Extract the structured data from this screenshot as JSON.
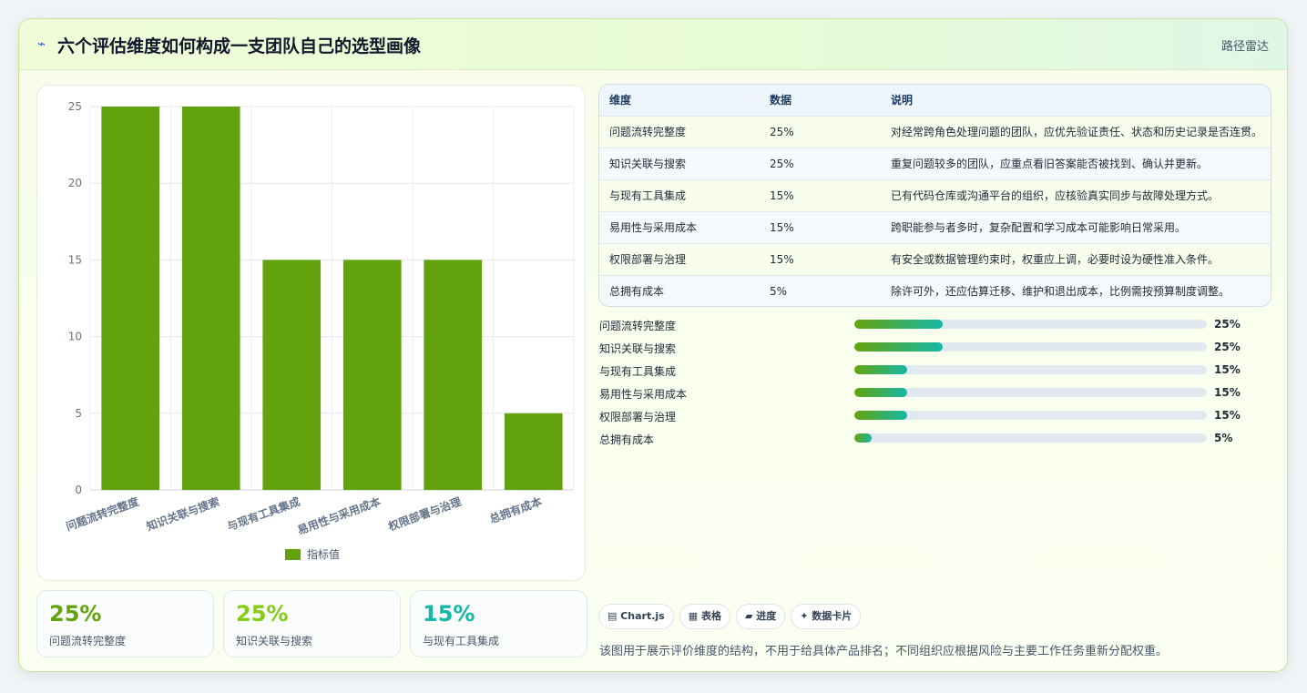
{
  "header": {
    "icon": "chart-line-icon",
    "title": "六个评估维度如何构成一支团队自己的选型画像",
    "right_label": "路径雷达"
  },
  "colors": {
    "bar": "#62a30d",
    "accent_green": "#65a30d",
    "accent_teal": "#14b8a6",
    "lime": "#84cc16"
  },
  "chart_data": {
    "type": "bar",
    "categories": [
      "问题流转完整度",
      "知识关联与搜索",
      "与现有工具集成",
      "易用性与采用成本",
      "权限部署与治理",
      "总拥有成本"
    ],
    "series": [
      {
        "name": "指标值",
        "values": [
          25,
          25,
          15,
          15,
          15,
          5
        ]
      }
    ],
    "ylim": [
      0,
      25
    ],
    "yticks": [
      0,
      5,
      10,
      15,
      20,
      25
    ],
    "grid": true,
    "legend": "bottom"
  },
  "stats": [
    {
      "value": "25%",
      "label": "问题流转完整度",
      "color": "#62a30d"
    },
    {
      "value": "25%",
      "label": "知识关联与搜索",
      "color": "#84cc16"
    },
    {
      "value": "15%",
      "label": "与现有工具集成",
      "color": "#14b8a6"
    }
  ],
  "table": {
    "headers": [
      "维度",
      "数据",
      "说明"
    ],
    "rows": [
      [
        "问题流转完整度",
        "25%",
        "对经常跨角色处理问题的团队，应优先验证责任、状态和历史记录是否连贯。"
      ],
      [
        "知识关联与搜索",
        "25%",
        "重复问题较多的团队，应重点看旧答案能否被找到、确认并更新。"
      ],
      [
        "与现有工具集成",
        "15%",
        "已有代码仓库或沟通平台的组织，应核验真实同步与故障处理方式。"
      ],
      [
        "易用性与采用成本",
        "15%",
        "跨职能参与者多时，复杂配置和学习成本可能影响日常采用。"
      ],
      [
        "权限部署与治理",
        "15%",
        "有安全或数据管理约束时，权重应上调，必要时设为硬性准入条件。"
      ],
      [
        "总拥有成本",
        "5%",
        "除许可外，还应估算迁移、维护和退出成本，比例需按预算制度调整。"
      ]
    ]
  },
  "progress": [
    {
      "label": "问题流转完整度",
      "value": 25,
      "text": "25%"
    },
    {
      "label": "知识关联与搜索",
      "value": 25,
      "text": "25%"
    },
    {
      "label": "与现有工具集成",
      "value": 15,
      "text": "15%"
    },
    {
      "label": "易用性与采用成本",
      "value": 15,
      "text": "15%"
    },
    {
      "label": "权限部署与治理",
      "value": 15,
      "text": "15%"
    },
    {
      "label": "总拥有成本",
      "value": 5,
      "text": "5%"
    }
  ],
  "pills": [
    "▤ Chart.js",
    "▦ 表格",
    "▰ 进度",
    "✦ 数据卡片"
  ],
  "note": "该图用于展示评价维度的结构，不用于给具体产品排名；不同组织应根据风险与主要工作任务重新分配权重。"
}
